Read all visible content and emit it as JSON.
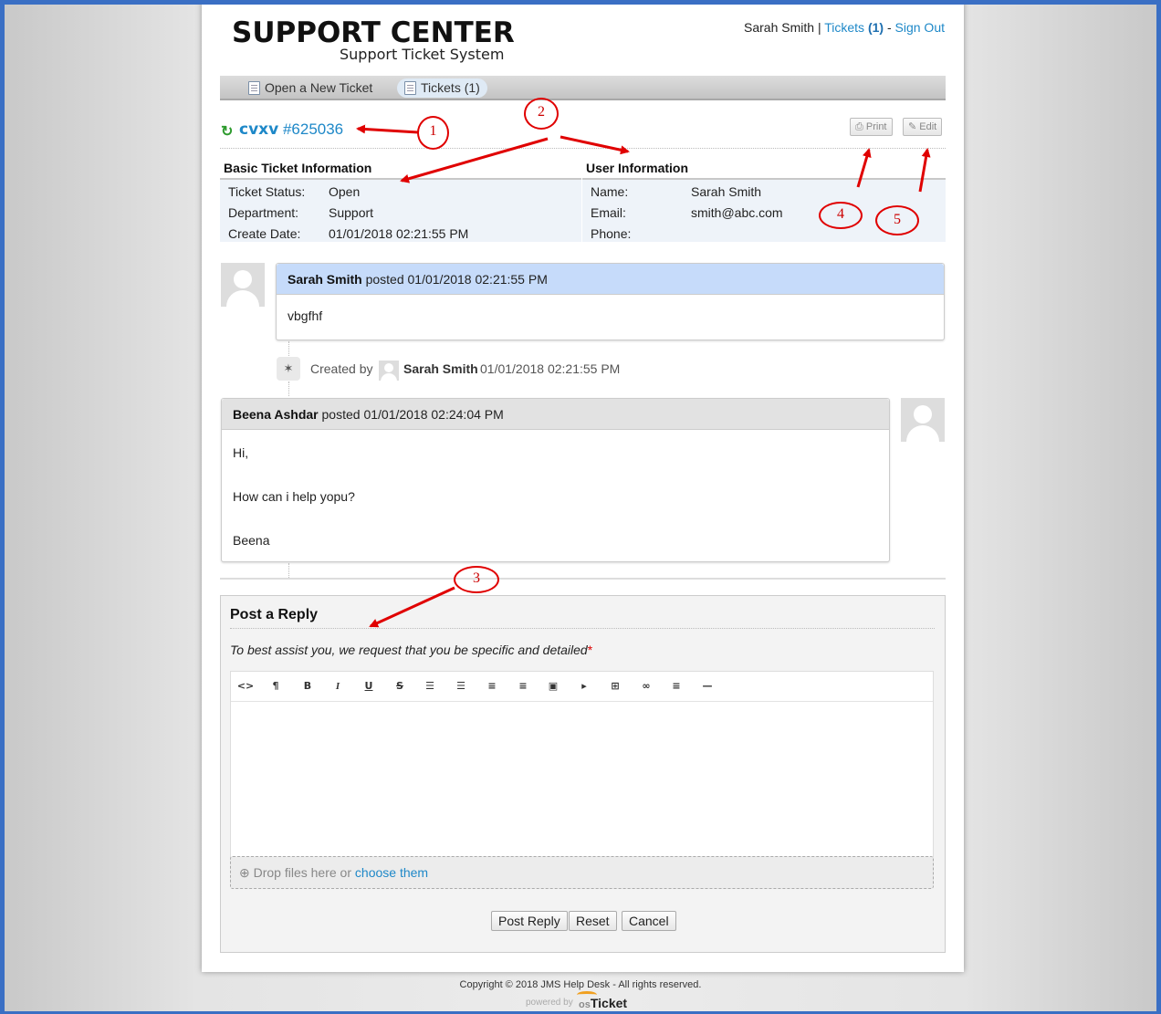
{
  "brand": {
    "title": "SUPPORT CENTER",
    "subtitle": "Support Ticket System"
  },
  "userbar": {
    "user": "Sarah Smith",
    "sep1": "|",
    "tickets_label": "Tickets",
    "tickets_count": "(1)",
    "sep2": "-",
    "sign_out": "Sign Out"
  },
  "nav": {
    "open_new": "Open a New Ticket",
    "tickets": "Tickets (1)"
  },
  "ticket": {
    "subject": "cvxv",
    "number": "#625036",
    "print": "Print",
    "edit": "Edit"
  },
  "basic_info": {
    "heading": "Basic Ticket Information",
    "status_label": "Ticket Status:",
    "status": "Open",
    "department_label": "Department:",
    "department": "Support",
    "create_label": "Create Date:",
    "create_date": "01/01/2018 02:21:55 PM"
  },
  "user_info": {
    "heading": "User Information",
    "name_label": "Name:",
    "name": "Sarah Smith",
    "email_label": "Email:",
    "email": "smith@abc.com",
    "phone_label": "Phone:",
    "phone": ""
  },
  "thread": {
    "msg1": {
      "author": "Sarah Smith",
      "posted": "posted 01/01/2018 02:21:55 PM",
      "body": "vbgfhf"
    },
    "event": {
      "prefix": "Created by",
      "author": "Sarah Smith",
      "time": "01/01/2018 02:21:55 PM"
    },
    "msg2": {
      "author": "Beena Ashdar",
      "posted": "posted 01/01/2018 02:24:04 PM",
      "line1": "Hi,",
      "line2": "How can i help yopu?",
      "line3": "Beena"
    }
  },
  "reply": {
    "title": "Post a Reply",
    "hint": "To best assist you, we request that you be specific and detailed",
    "required_mark": "*",
    "toolbar_icons": [
      "code-icon",
      "paragraph-icon",
      "bold-icon",
      "italic-icon",
      "underline-icon",
      "strikethrough-icon",
      "unordered-list-icon",
      "ordered-list-icon",
      "outdent-icon",
      "indent-icon",
      "image-icon",
      "video-icon",
      "table-icon",
      "link-icon",
      "align-icon",
      "horizontal-rule-icon"
    ],
    "drop_text": "Drop files here or",
    "choose": "choose them",
    "post_button": "Post Reply",
    "reset_button": "Reset",
    "cancel_button": "Cancel"
  },
  "footer": {
    "copyright": "Copyright © 2018 JMS Help Desk - All rights reserved.",
    "powered_by": "powered by",
    "os": "os",
    "ticket": "Ticket"
  },
  "annotations": {
    "a1": "1",
    "a2": "2",
    "a3": "3",
    "a4": "4",
    "a5": "5"
  },
  "colors": {
    "link": "#1e88c8",
    "refresh": "#2e9b2e",
    "annotation": "#e00000",
    "frame": "#3a6fc4",
    "info_bg": "#eef3f9",
    "user_header": "#c6dbfa",
    "staff_header": "#e2e2e2"
  }
}
